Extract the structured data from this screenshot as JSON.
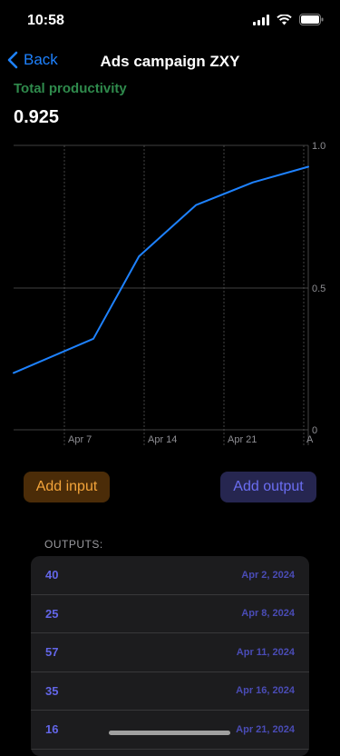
{
  "status_bar": {
    "time": "10:58"
  },
  "nav": {
    "back_label": "Back",
    "title": "Ads campaign ZXY"
  },
  "metric": {
    "label": "Total productivity",
    "value": "0.925"
  },
  "chart_data": {
    "type": "line",
    "x": [
      "2024-03-31",
      "2024-04-07",
      "2024-04-11",
      "2024-04-16",
      "2024-04-21",
      "2024-04-28"
    ],
    "series": [
      {
        "values": [
          0.2,
          0.32,
          0.61,
          0.79,
          0.87,
          0.925
        ]
      }
    ],
    "x_tick_labels": [
      "Apr 7",
      "Apr 14",
      "Apr 21",
      "A"
    ],
    "y_tick_labels": [
      "1.0",
      "0.5",
      "0"
    ],
    "ylim": [
      0,
      1
    ],
    "grid": true,
    "line_color": "#1e82ff"
  },
  "buttons": {
    "add_input": "Add input",
    "add_output": "Add output"
  },
  "outputs": {
    "header": "OUTPUTS:",
    "rows": [
      {
        "value": "40",
        "date": "Apr 2, 2024"
      },
      {
        "value": "25",
        "date": "Apr 8, 2024"
      },
      {
        "value": "57",
        "date": "Apr 11, 2024"
      },
      {
        "value": "35",
        "date": "Apr 16, 2024"
      },
      {
        "value": "16",
        "date": "Apr 21, 2024"
      }
    ]
  },
  "colors": {
    "accent": "#1e82ff",
    "metric_label": "#2f8a4c",
    "input_button_text": "#f3a43a",
    "output_button_text": "#6b6ef2"
  }
}
